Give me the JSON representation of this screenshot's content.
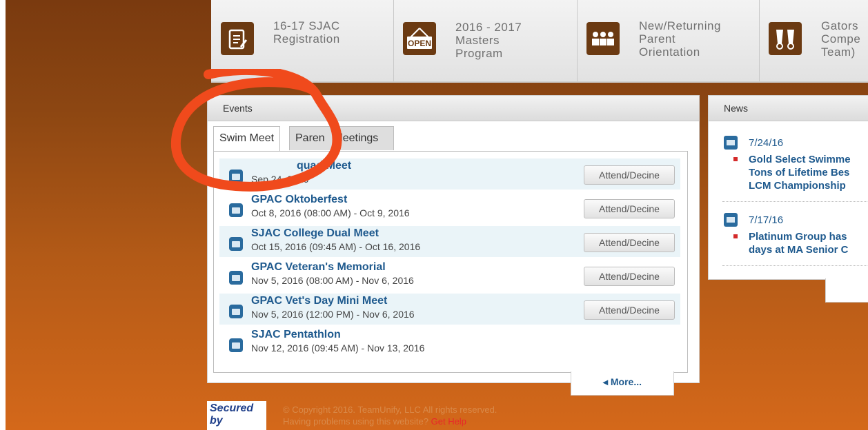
{
  "nav": {
    "tiles": [
      {
        "label": "16-17 SJAC\nRegistration",
        "icon": "clipboard-icon"
      },
      {
        "label": "2016 - 2017\nMasters\nProgram",
        "icon": "open-sign-icon"
      },
      {
        "label": "New/Returning\nParent\nOrientation",
        "icon": "group-icon"
      },
      {
        "label": "Gators\nCompe\nTeam)",
        "icon": "swim-fins-icon"
      }
    ]
  },
  "events": {
    "title": "Events",
    "tabs": [
      "Swim Meet",
      "Parent Meetings"
    ],
    "tab_visible": [
      "Swim Meet",
      "Paren",
      "leetings"
    ],
    "items": [
      {
        "title": "quad Meet",
        "date": "Sep 24, 2016",
        "action": "Attend/Decine"
      },
      {
        "title": "GPAC Oktoberfest",
        "date": "Oct 8, 2016 (08:00 AM) - Oct 9, 2016",
        "action": "Attend/Decine"
      },
      {
        "title": "SJAC College Dual Meet",
        "date": "Oct 15, 2016 (09:45 AM) - Oct 16, 2016",
        "action": "Attend/Decine"
      },
      {
        "title": "GPAC Veteran's Memorial",
        "date": "Nov 5, 2016 (08:00 AM) - Nov 6, 2016",
        "action": "Attend/Decine"
      },
      {
        "title": "GPAC Vet's Day Mini Meet",
        "date": "Nov 5, 2016 (12:00 PM) - Nov 6, 2016",
        "action": "Attend/Decine"
      },
      {
        "title": "SJAC Pentathlon",
        "date": "Nov 12, 2016 (09:45 AM) - Nov 13, 2016",
        "action": ""
      }
    ],
    "more": "◂ More..."
  },
  "news": {
    "title": "News",
    "items": [
      {
        "date": "7/24/16",
        "text": "Gold Select Swimme\nTons of Lifetime Bes\nLCM Championship"
      },
      {
        "date": "7/17/16",
        "text": "Platinum Group has\ndays at MA Senior C"
      }
    ]
  },
  "footer": {
    "secured": "Secured by",
    "copyright": "© Copyright 2016. TeamUnify, LLC All rights reserved.",
    "problems": "Having problems using this website?",
    "help": "Get Help"
  },
  "colors": {
    "link": "#1f5a8e",
    "accent_bg": "#b35a17",
    "annotation": "#f04a1c"
  }
}
